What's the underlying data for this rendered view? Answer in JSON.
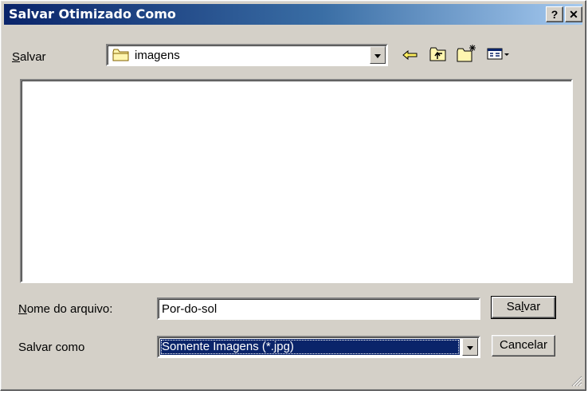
{
  "window": {
    "title": "Salvar Otimizado Como",
    "help_label": "?",
    "close_label": "✕"
  },
  "save_in": {
    "label_first": "S",
    "label_rest": "alvar",
    "folder": "imagens"
  },
  "filename": {
    "label_first": "N",
    "label_rest": "ome do arquivo:",
    "value": "Por-do-sol"
  },
  "save_as": {
    "label": "Salvar como",
    "value": "Somente Imagens (*.jpg)"
  },
  "buttons": {
    "save_a": "Sa",
    "save_b": "l",
    "save_c": "var",
    "cancel": "Cancelar"
  },
  "icons": [
    "folder-icon",
    "back-arrow-icon",
    "up-folder-icon",
    "new-folder-icon",
    "view-menu-icon"
  ]
}
